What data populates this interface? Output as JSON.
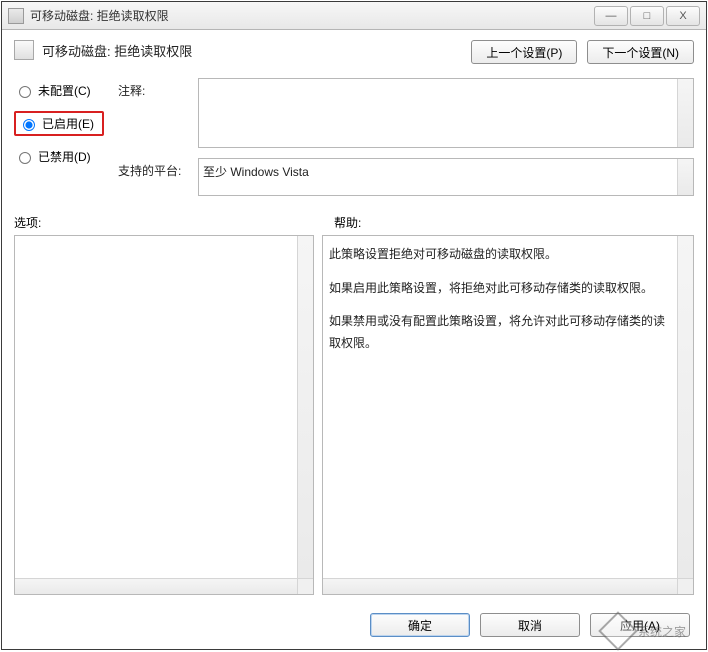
{
  "window": {
    "title": "可移动磁盘: 拒绝读取权限",
    "controls": {
      "min": "—",
      "max": "□",
      "close": "X"
    }
  },
  "policy": {
    "title": "可移动磁盘: 拒绝读取权限"
  },
  "nav": {
    "prev": "上一个设置(P)",
    "next": "下一个设置(N)"
  },
  "radios": {
    "not_configured": "未配置(C)",
    "enabled": "已启用(E)",
    "disabled": "已禁用(D)",
    "selected": "enabled"
  },
  "fields": {
    "comment_label": "注释:",
    "comment_value": "",
    "platform_label": "支持的平台:",
    "platform_value": "至少 Windows Vista"
  },
  "sections": {
    "options_label": "选项:",
    "help_label": "帮助:"
  },
  "help": {
    "p1": "此策略设置拒绝对可移动磁盘的读取权限。",
    "p2": "如果启用此策略设置，将拒绝对此可移动存储类的读取权限。",
    "p3": "如果禁用或没有配置此策略设置，将允许对此可移动存储类的读取权限。"
  },
  "footer": {
    "ok": "确定",
    "cancel": "取消",
    "apply": "应用(A)"
  },
  "watermark": "系统之家"
}
